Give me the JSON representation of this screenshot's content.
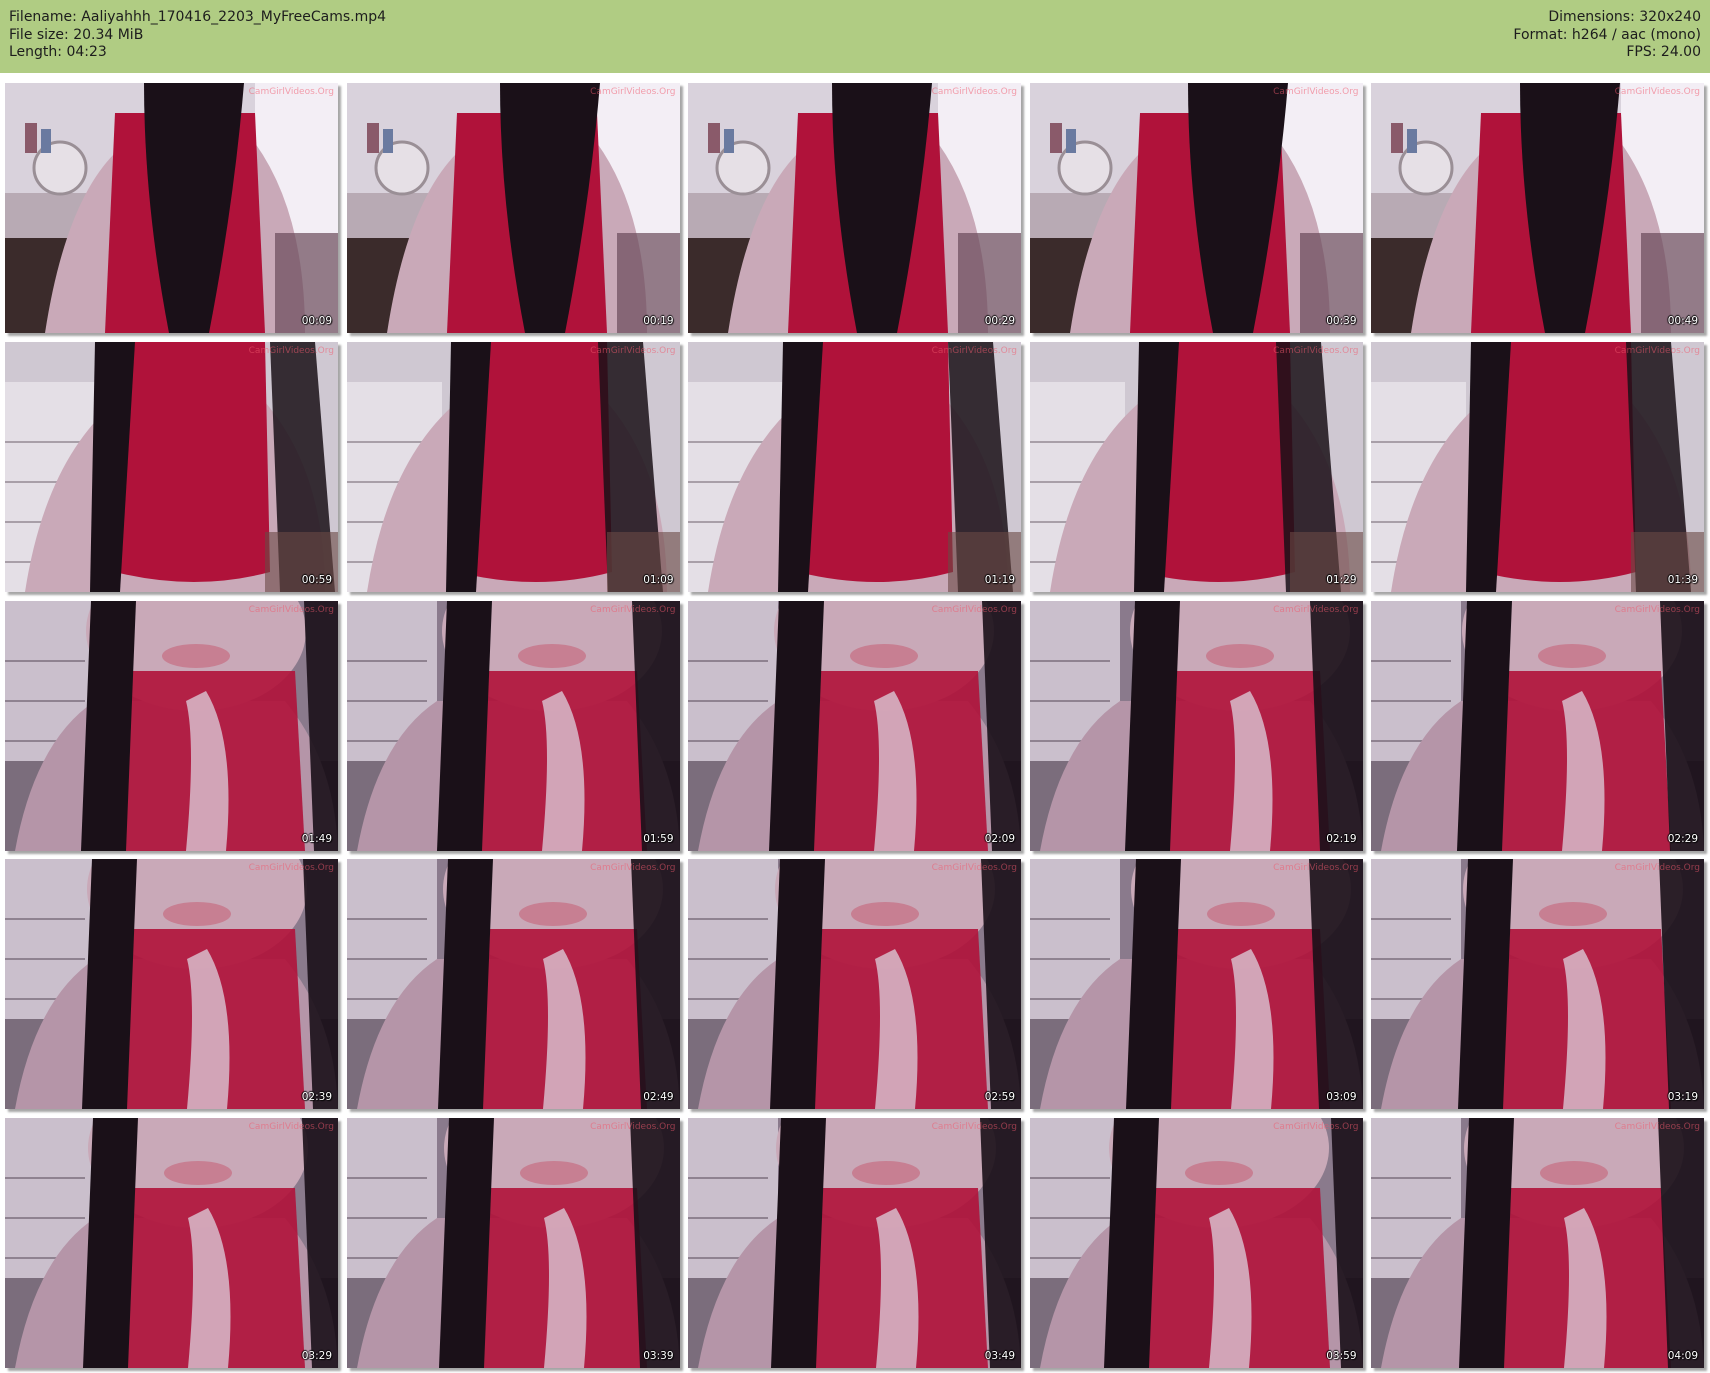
{
  "header": {
    "filename": "Filename: Aaliyahhh_170416_2203_MyFreeCams.mp4",
    "filesize": "File size: 20.34 MiB",
    "length": "Length: 04:23",
    "dimensions": "Dimensions: 320x240",
    "format": "Format: h264 / aac (mono)",
    "fps": "FPS: 24.00"
  },
  "watermark": "CamGirlVideos.Org",
  "frames": [
    {
      "time": "00:09",
      "scene": "room"
    },
    {
      "time": "00:19",
      "scene": "room"
    },
    {
      "time": "00:29",
      "scene": "room"
    },
    {
      "time": "00:39",
      "scene": "room"
    },
    {
      "time": "00:49",
      "scene": "room"
    },
    {
      "time": "00:59",
      "scene": "mid"
    },
    {
      "time": "01:09",
      "scene": "mid"
    },
    {
      "time": "01:19",
      "scene": "mid"
    },
    {
      "time": "01:29",
      "scene": "mid"
    },
    {
      "time": "01:39",
      "scene": "mid"
    },
    {
      "time": "01:49",
      "scene": "close"
    },
    {
      "time": "01:59",
      "scene": "close"
    },
    {
      "time": "02:09",
      "scene": "close"
    },
    {
      "time": "02:19",
      "scene": "close"
    },
    {
      "time": "02:29",
      "scene": "close"
    },
    {
      "time": "02:39",
      "scene": "close"
    },
    {
      "time": "02:49",
      "scene": "close"
    },
    {
      "time": "02:59",
      "scene": "close"
    },
    {
      "time": "03:09",
      "scene": "close"
    },
    {
      "time": "03:19",
      "scene": "close"
    },
    {
      "time": "03:29",
      "scene": "close"
    },
    {
      "time": "03:39",
      "scene": "close"
    },
    {
      "time": "03:49",
      "scene": "close"
    },
    {
      "time": "03:59",
      "scene": "close"
    },
    {
      "time": "04:09",
      "scene": "close"
    }
  ],
  "colors": {
    "header_bg": "#b0cc83",
    "header_text": "#1d1d1d",
    "dress": "#b0123a",
    "hair": "#1a1018",
    "skin": "#c9a9b8",
    "wall": "#d9d2dc",
    "shadow": "#3a2a3a"
  }
}
